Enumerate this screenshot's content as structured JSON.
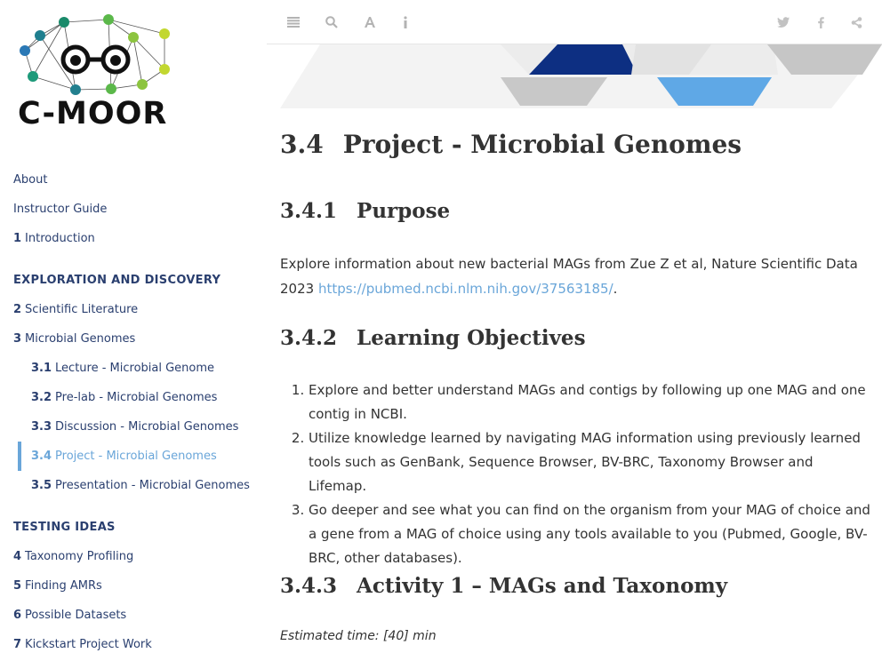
{
  "logo": {
    "text": "C-MOOR"
  },
  "sidebar": {
    "top_items": [
      {
        "num": "",
        "label": "About"
      },
      {
        "num": "",
        "label": "Instructor Guide"
      },
      {
        "num": "1",
        "label": "Introduction"
      }
    ],
    "section1_header": "EXPLORATION AND DISCOVERY",
    "section1_items": [
      {
        "num": "2",
        "label": "Scientific Literature",
        "level": 0
      },
      {
        "num": "3",
        "label": "Microbial Genomes",
        "level": 0
      },
      {
        "num": "3.1",
        "label": "Lecture - Microbial Genome",
        "level": 1
      },
      {
        "num": "3.2",
        "label": "Pre-lab - Microbial Genomes",
        "level": 1
      },
      {
        "num": "3.3",
        "label": "Discussion - Microbial Genomes",
        "level": 1
      },
      {
        "num": "3.4",
        "label": "Project - Microbial Genomes",
        "level": 1,
        "active": true
      },
      {
        "num": "3.5",
        "label": "Presentation - Microbial Genomes",
        "level": 1
      }
    ],
    "section2_header": "TESTING IDEAS",
    "section2_items": [
      {
        "num": "4",
        "label": "Taxonomy Profiling"
      },
      {
        "num": "5",
        "label": "Finding AMRs"
      },
      {
        "num": "6",
        "label": "Possible Datasets"
      },
      {
        "num": "7",
        "label": "Kickstart Project Work"
      }
    ]
  },
  "toolbar": {
    "left_icons": [
      "menu-icon",
      "search-icon",
      "font-icon",
      "info-icon"
    ],
    "right_icons": [
      "twitter-icon",
      "facebook-icon",
      "share-icon"
    ]
  },
  "content": {
    "chapter_num": "3.4",
    "chapter_title": "Project - Microbial Genomes",
    "purpose_num": "3.4.1",
    "purpose_title": "Purpose",
    "purpose_text": "Explore information about new bacterial MAGs from Zue Z et al, Nature Scientific Data 2023 ",
    "purpose_link": "https://pubmed.ncbi.nlm.nih.gov/37563185/",
    "purpose_end": ".",
    "objectives_num": "3.4.2",
    "objectives_title": "Learning Objectives",
    "objectives": [
      "Explore and better understand MAGs and contigs by following up one MAG and one contig in NCBI.",
      "Utilize knowledge learned by navigating MAG information using previously learned tools such as GenBank, Sequence Browser, BV-BRC, Taxonomy Browser and Lifemap.",
      "Go deeper and see what you can find on the organism from your MAG of choice and a gene from a MAG of choice using any tools available to you (Pubmed, Google, BV-BRC, other databases)."
    ],
    "activity_num": "3.4.3",
    "activity_title": "Activity 1 – MAGs and Taxonomy",
    "estimated_time": "Estimated time: [40] min"
  },
  "colors": {
    "nav_text": "#2a3f6f",
    "active": "#6aa6d9",
    "link": "#6aa6d9",
    "banner_dark": "#0d2f82",
    "banner_light_blue": "#5fa8e6",
    "banner_gray": "#c8c8c8"
  }
}
